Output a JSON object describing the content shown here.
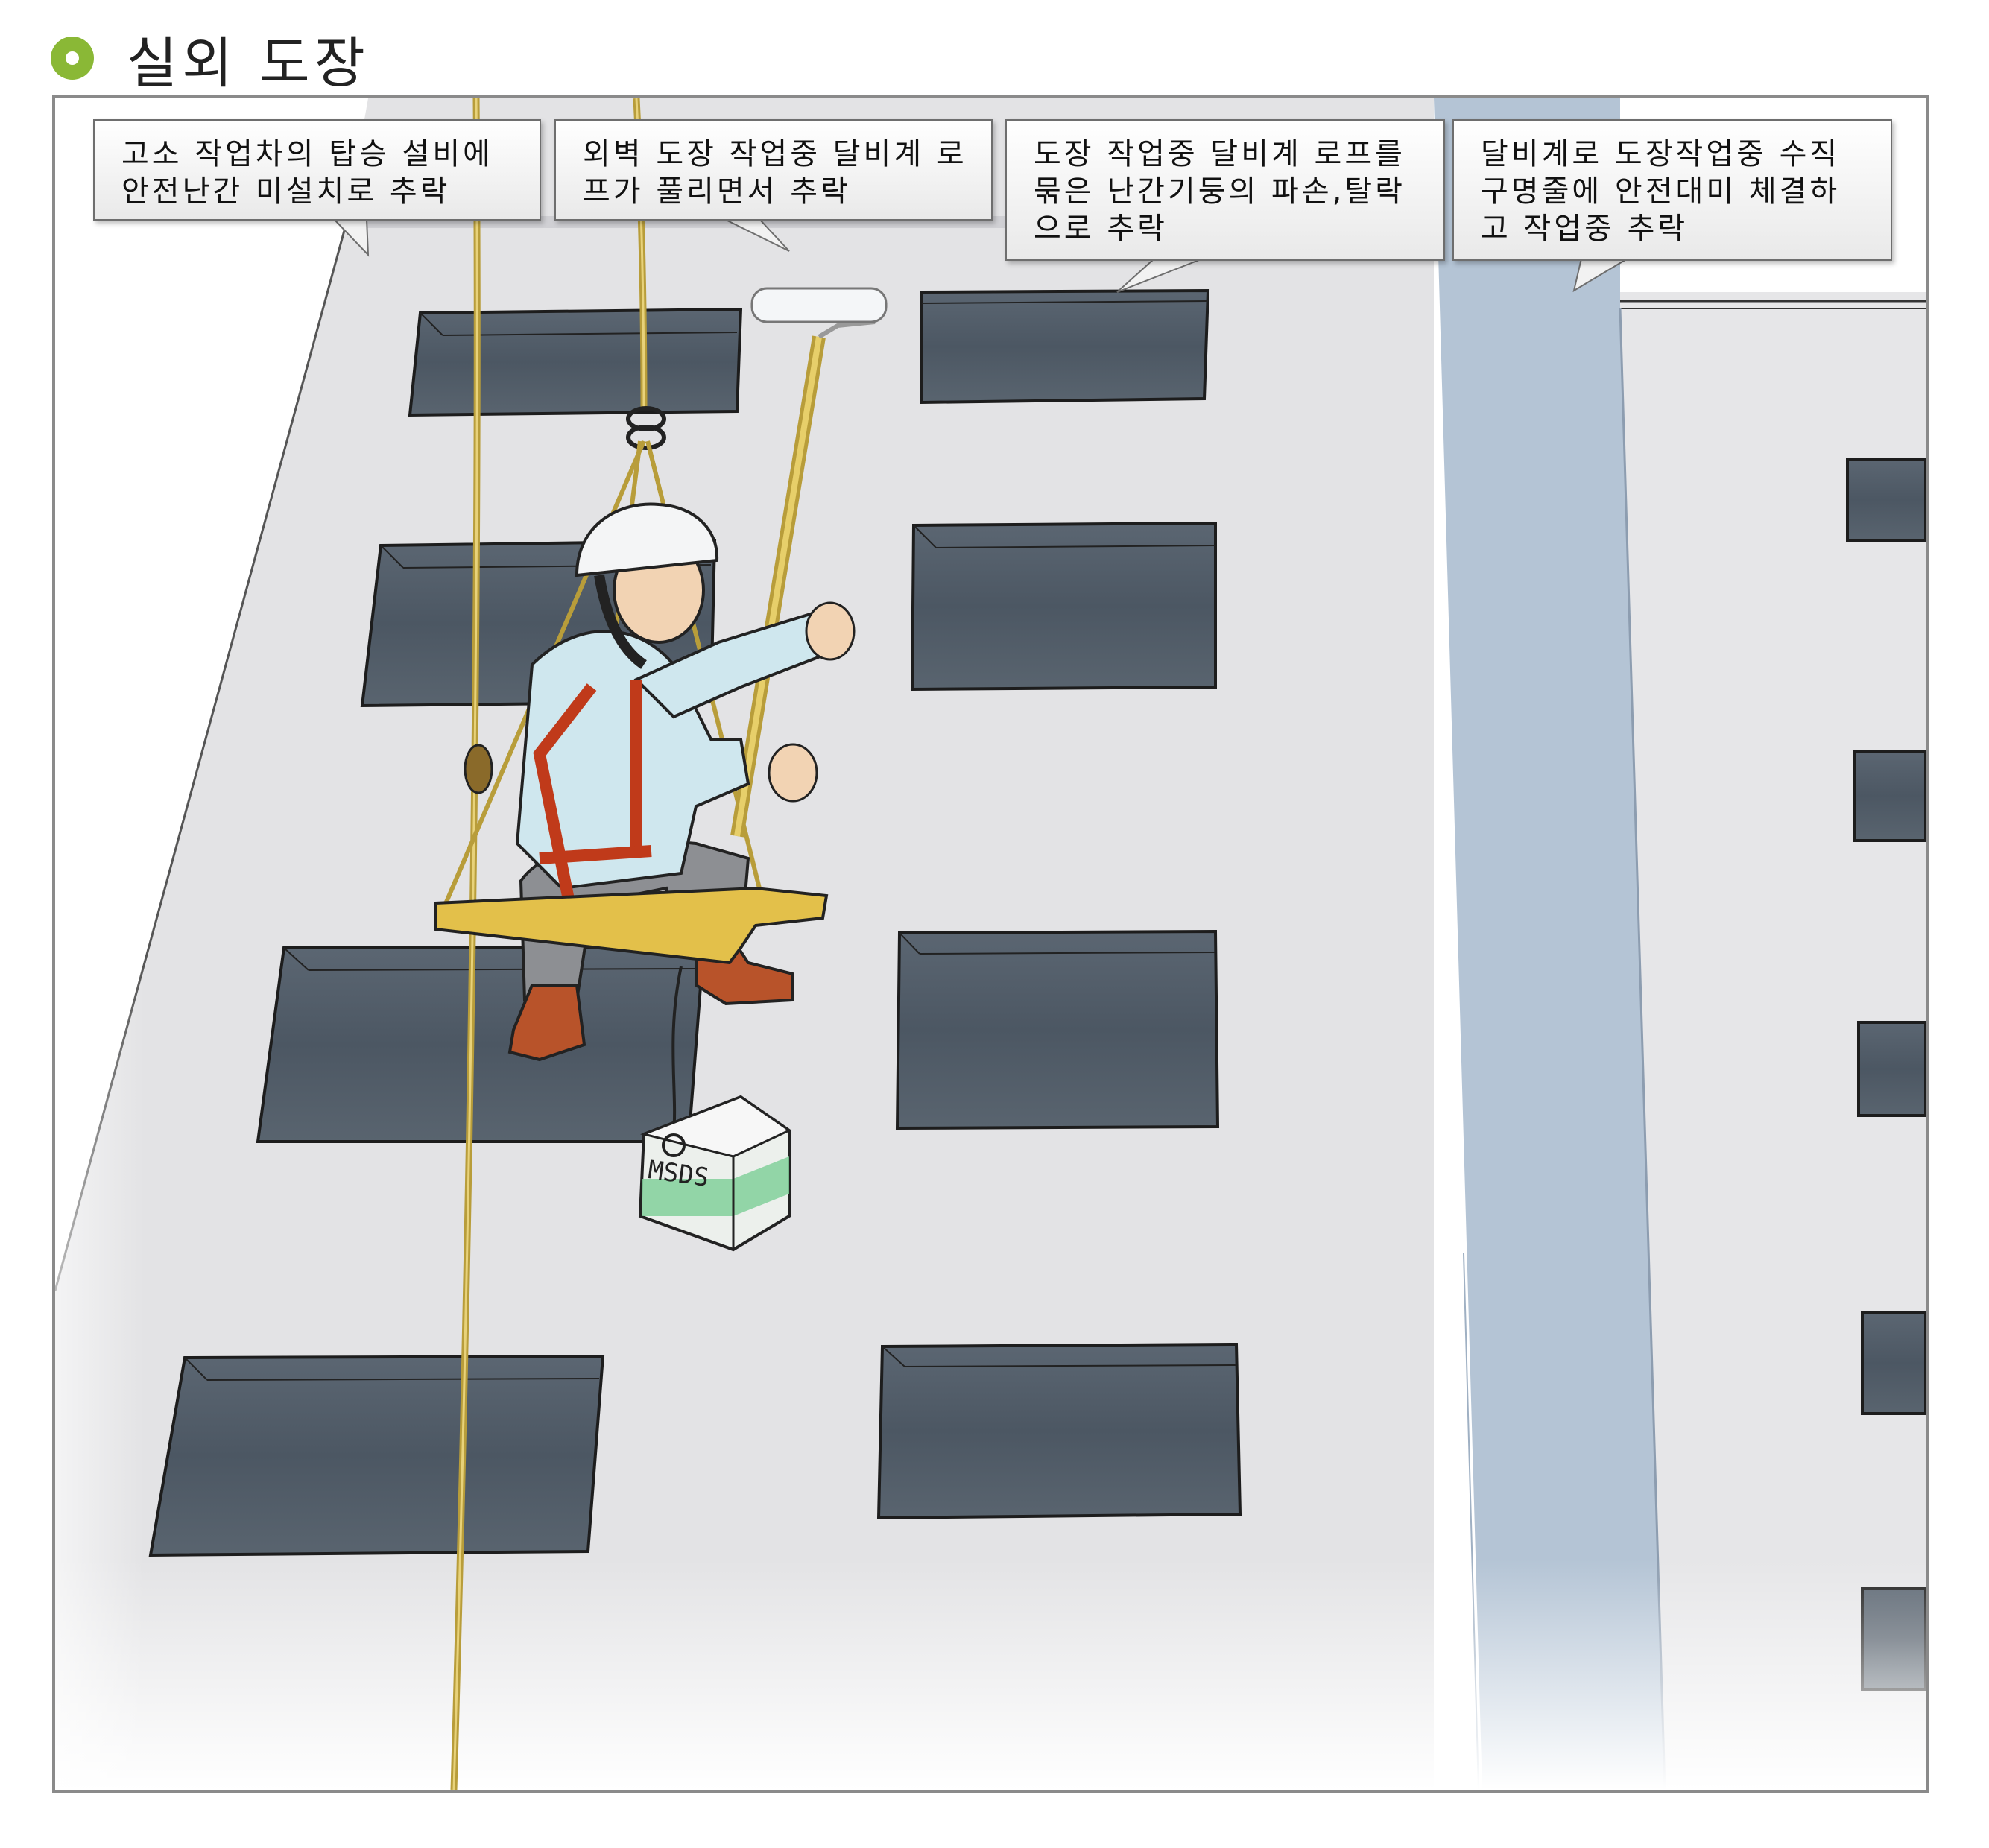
{
  "page": {
    "title": "실외 도장"
  },
  "illustration": {
    "bucket_label": "MSDS"
  },
  "callouts": [
    {
      "text": "고소 작업차의 탑승 설비에\n안전난간 미설치로 추락"
    },
    {
      "text": "외벽 도장 작업중 달비계 로\n프가 풀리면서 추락"
    },
    {
      "text": "도장 작업중 달비계 로프를\n묶은 난간기둥의 파손,탈락\n으로 추락"
    },
    {
      "text": "달비계로 도장작업중 수직\n구명줄에 안전대미 체결하\n고 작업중 추락"
    }
  ],
  "colors": {
    "accent": "#8ab836",
    "wall": "#e3e3e5",
    "window": "#4e5a66",
    "pillar": "#b3c3d4",
    "rope": "#c9b24a",
    "harness": "#e0502c",
    "bucket": "#7fcf97"
  }
}
